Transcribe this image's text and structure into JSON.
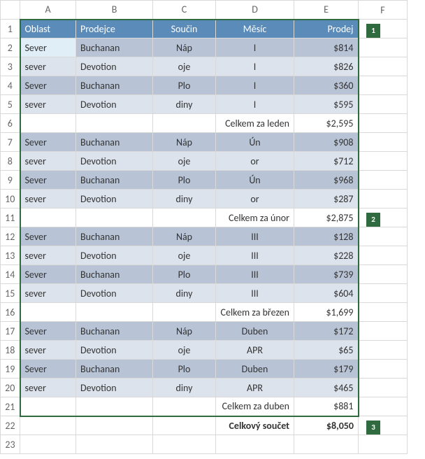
{
  "columns": [
    "A",
    "B",
    "C",
    "D",
    "E",
    "F"
  ],
  "headers": {
    "oblast": "Oblast",
    "prodejce": "Prodejce",
    "soucin": "Součin",
    "mesic": "Měsíc",
    "prodej": "Prodej"
  },
  "chart_data": {
    "type": "table",
    "columns": [
      "Oblast",
      "Prodejce",
      "Součin",
      "Měsíc",
      "Prodej"
    ],
    "rows": [
      {
        "r": 2,
        "oblast": "Sever",
        "prodejce": "Buchanan",
        "soucin": "Náp",
        "mesic": "I",
        "prodej": "$814",
        "band": "dark",
        "sel": true
      },
      {
        "r": 3,
        "oblast": "sever",
        "prodejce": "Devotion",
        "soucin": "oje",
        "mesic": "I",
        "prodej": "$826",
        "band": "light"
      },
      {
        "r": 4,
        "oblast": "Sever",
        "prodejce": "Buchanan",
        "soucin": "Plo",
        "mesic": "I",
        "prodej": "$360",
        "band": "dark"
      },
      {
        "r": 5,
        "oblast": "sever",
        "prodejce": "Devotion",
        "soucin": "diny",
        "mesic": "I",
        "prodej": "$595",
        "band": "light"
      },
      {
        "r": 6,
        "subtotal": true,
        "label": "Celkem za leden",
        "prodej": "$2,595"
      },
      {
        "r": 7,
        "oblast": "Sever",
        "prodejce": "Buchanan",
        "soucin": "Náp",
        "mesic": "Ún",
        "prodej": "$908",
        "band": "dark"
      },
      {
        "r": 8,
        "oblast": "sever",
        "prodejce": "Devotion",
        "soucin": "oje",
        "mesic": "or",
        "prodej": "$712",
        "band": "light"
      },
      {
        "r": 9,
        "oblast": "Sever",
        "prodejce": "Buchanan",
        "soucin": "Plo",
        "mesic": "Ún",
        "prodej": "$968",
        "band": "dark"
      },
      {
        "r": 10,
        "oblast": "sever",
        "prodejce": "Devotion",
        "soucin": "diny",
        "mesic": "or",
        "prodej": "$287",
        "band": "light"
      },
      {
        "r": 11,
        "subtotal": true,
        "label": "Celkem za únor",
        "prodej": "$2,875"
      },
      {
        "r": 12,
        "oblast": "Sever",
        "prodejce": "Buchanan",
        "soucin": "Náp",
        "mesic": "III",
        "prodej": "$128",
        "band": "dark"
      },
      {
        "r": 13,
        "oblast": "sever",
        "prodejce": "Devotion",
        "soucin": "oje",
        "mesic": "III",
        "prodej": "$228",
        "band": "light"
      },
      {
        "r": 14,
        "oblast": "Sever",
        "prodejce": "Buchanan",
        "soucin": "Plo",
        "mesic": "III",
        "prodej": "$739",
        "band": "dark"
      },
      {
        "r": 15,
        "oblast": "sever",
        "prodejce": "Devotion",
        "soucin": "diny",
        "mesic": "III",
        "prodej": "$604",
        "band": "light"
      },
      {
        "r": 16,
        "subtotal": true,
        "label": "Celkem za březen",
        "prodej": "$1,699"
      },
      {
        "r": 17,
        "oblast": "Sever",
        "prodejce": "Buchanan",
        "soucin": "Náp",
        "mesic": "Duben",
        "prodej": "$172",
        "band": "dark"
      },
      {
        "r": 18,
        "oblast": "sever",
        "prodejce": "Devotion",
        "soucin": "oje",
        "mesic": "APR",
        "prodej": "$65",
        "band": "light"
      },
      {
        "r": 19,
        "oblast": "Sever",
        "prodejce": "Buchanan",
        "soucin": "Plo",
        "mesic": "Duben",
        "prodej": "$179",
        "band": "dark"
      },
      {
        "r": 20,
        "oblast": "sever",
        "prodejce": "Devotion",
        "soucin": "diny",
        "mesic": "APR",
        "prodej": "$465",
        "band": "light"
      },
      {
        "r": 21,
        "subtotal": true,
        "label": "Celkem za duben",
        "prodej": "$881",
        "last": true
      },
      {
        "r": 22,
        "grand": true,
        "label": "Celkový součet",
        "prodej": "$8,050"
      },
      {
        "r": 23,
        "empty": true
      }
    ]
  },
  "callouts": {
    "c1": "1",
    "c2": "2",
    "c3": "3"
  }
}
